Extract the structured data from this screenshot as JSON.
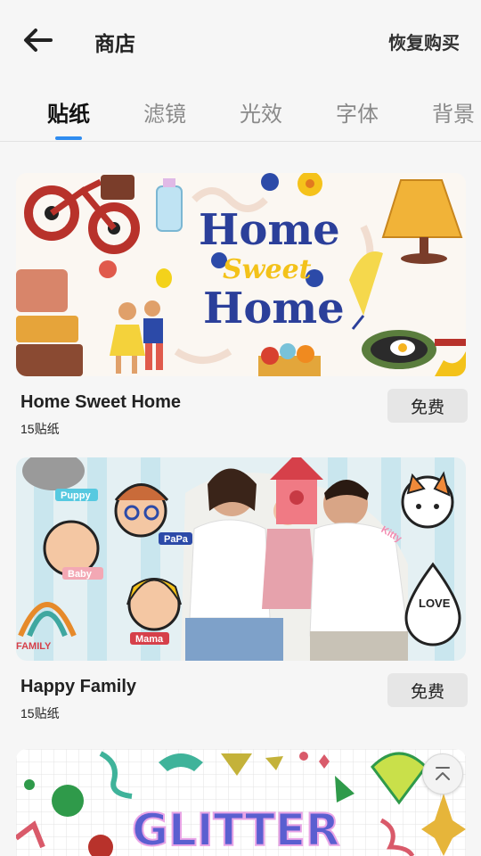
{
  "header": {
    "title": "商店",
    "restore_label": "恢复购买"
  },
  "tabs": [
    {
      "label": "贴纸",
      "active": true
    },
    {
      "label": "滤镜",
      "active": false
    },
    {
      "label": "光效",
      "active": false
    },
    {
      "label": "字体",
      "active": false
    },
    {
      "label": "背景",
      "active": false
    }
  ],
  "packs": [
    {
      "name": "Home Sweet Home",
      "count": "15贴纸",
      "price_label": "免费",
      "banner_lines": [
        "Home",
        "Sweet",
        "Home"
      ]
    },
    {
      "name": "Happy Family",
      "count": "15贴纸",
      "price_label": "免费",
      "sticker_labels": [
        "Puppy",
        "PaPa",
        "Baby",
        "Mama",
        "FAMILY",
        "Kitty",
        "LOVE"
      ]
    },
    {
      "name": "",
      "count": "",
      "price_label": "",
      "banner_lines": [
        "GLITTER"
      ]
    }
  ],
  "colors": {
    "accent": "#2f8cf0",
    "background": "#f6f6f6",
    "button_bg": "#e6e6e6"
  },
  "icons": {
    "back": "arrow-left-icon",
    "scroll_top": "chevron-up-bar-icon"
  }
}
